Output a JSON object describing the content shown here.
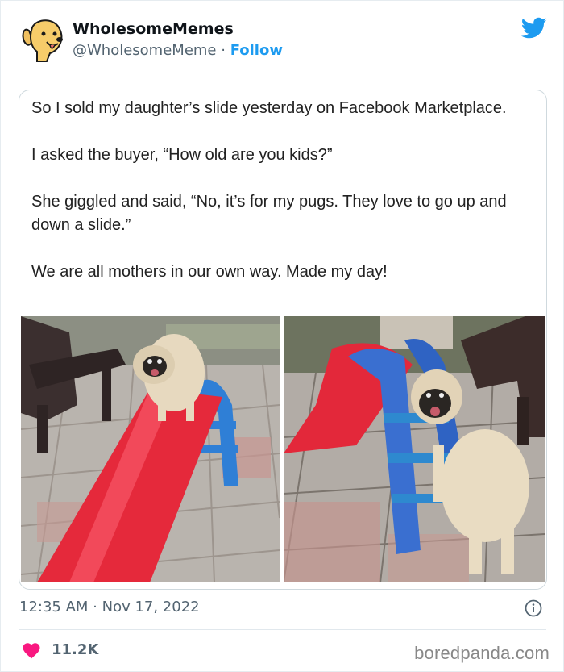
{
  "tweet": {
    "display_name": "WholesomeMemes",
    "handle": "@WholesomeMeme",
    "separator": " · ",
    "follow_label": "Follow",
    "timestamp": "12:35 AM · Nov 17, 2022",
    "likes": "11.2K",
    "icons": {
      "brand": "twitter-bird-icon",
      "info": "info-icon",
      "like": "heart-icon"
    },
    "colors": {
      "accent": "#1d9bf0",
      "heart": "#f91880",
      "muted": "#536471"
    }
  },
  "meme": {
    "lines": [
      "So I sold my daughter’s slide yesterday on Facebook Marketplace.",
      "I asked the buyer, “How old are you kids?”",
      "She giggled and said, “No, it’s for my pugs. They love to go up and down a slide.”",
      "We are all mothers in our own way. Made my day!"
    ]
  },
  "watermark": "boredpanda.com"
}
